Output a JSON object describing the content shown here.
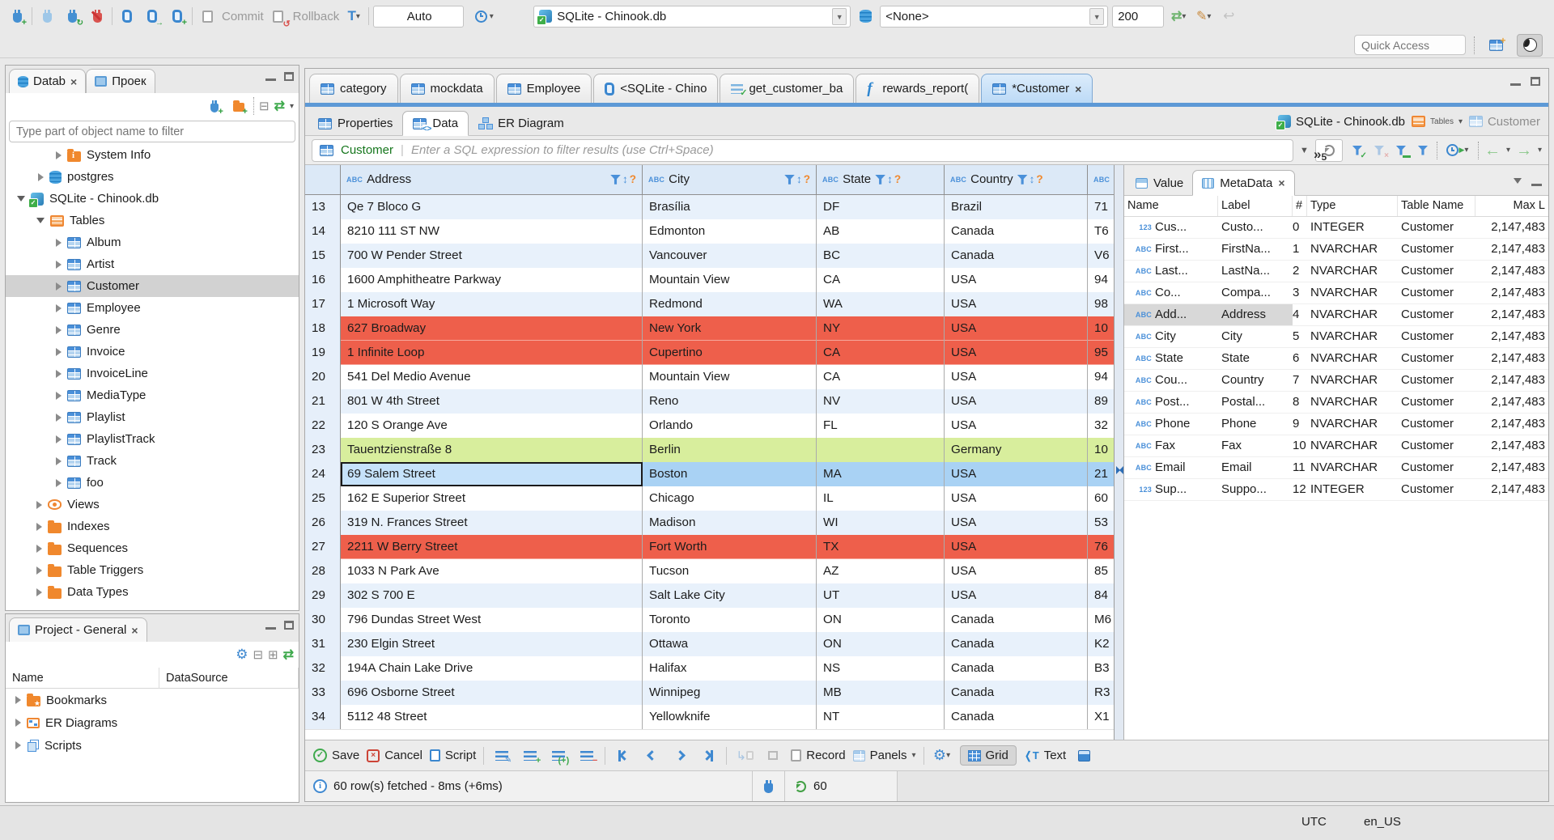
{
  "window": {
    "quick_access": "Quick Access"
  },
  "toolbar": {
    "commit": "Commit",
    "rollback": "Rollback",
    "auto": "Auto",
    "connection": "SQLite - Chinook.db",
    "schema": "<None>",
    "fetch_size": "200"
  },
  "left": {
    "nav_tab": "Datab",
    "nav_tab2": "Проек",
    "filter_placeholder": "Type part of object name to filter",
    "tree": [
      {
        "label": "System Info",
        "icon": "foldinfo",
        "arrow": "r",
        "ind": 62
      },
      {
        "label": "postgres",
        "icon": "db",
        "arrow": "r",
        "ind": 40
      },
      {
        "label": "SQLite - Chinook.db",
        "icon": "sqlite",
        "arrow": "d",
        "ind": 14
      },
      {
        "label": "Tables",
        "icon": "ftable",
        "arrow": "d",
        "ind": 38
      },
      {
        "label": "Album",
        "icon": "table",
        "arrow": "r",
        "ind": 62
      },
      {
        "label": "Artist",
        "icon": "table",
        "arrow": "r",
        "ind": 62
      },
      {
        "label": "Customer",
        "icon": "table",
        "arrow": "r",
        "ind": 62,
        "sel": "sel"
      },
      {
        "label": "Employee",
        "icon": "table",
        "arrow": "r",
        "ind": 62
      },
      {
        "label": "Genre",
        "icon": "table",
        "arrow": "r",
        "ind": 62
      },
      {
        "label": "Invoice",
        "icon": "table",
        "arrow": "r",
        "ind": 62
      },
      {
        "label": "InvoiceLine",
        "icon": "table",
        "arrow": "r",
        "ind": 62
      },
      {
        "label": "MediaType",
        "icon": "table",
        "arrow": "r",
        "ind": 62
      },
      {
        "label": "Playlist",
        "icon": "table",
        "arrow": "r",
        "ind": 62
      },
      {
        "label": "PlaylistTrack",
        "icon": "table",
        "arrow": "r",
        "ind": 62
      },
      {
        "label": "Track",
        "icon": "table",
        "arrow": "r",
        "ind": 62
      },
      {
        "label": "foo",
        "icon": "table",
        "arrow": "r",
        "ind": 62
      },
      {
        "label": "Views",
        "icon": "eye",
        "arrow": "r",
        "ind": 38
      },
      {
        "label": "Indexes",
        "icon": "folder",
        "arrow": "r",
        "ind": 38
      },
      {
        "label": "Sequences",
        "icon": "folder",
        "arrow": "r",
        "ind": 38
      },
      {
        "label": "Table Triggers",
        "icon": "folder",
        "arrow": "r",
        "ind": 38
      },
      {
        "label": "Data Types",
        "icon": "folder",
        "arrow": "r",
        "ind": 38
      }
    ],
    "project_tab": "Project - General",
    "project_cols": [
      "Name",
      "DataSource"
    ],
    "project_items": [
      {
        "label": "Bookmarks",
        "icon": "foldstar"
      },
      {
        "label": "ER Diagrams",
        "icon": "er"
      },
      {
        "label": "Scripts",
        "icon": "pages"
      }
    ]
  },
  "editor_tabs": [
    {
      "label": "category",
      "icon": "table"
    },
    {
      "label": "mockdata",
      "icon": "table"
    },
    {
      "label": "Employee",
      "icon": "table"
    },
    {
      "label": "<SQLite - Chino",
      "icon": "sqlpage"
    },
    {
      "label": "get_customer_ba",
      "icon": "script"
    },
    {
      "label": "rewards_report(",
      "icon": "func"
    },
    {
      "label": "*Customer",
      "icon": "table",
      "state": "active"
    }
  ],
  "tabs_overflow": "5",
  "subtabs": [
    {
      "label": "Properties",
      "icon": "table"
    },
    {
      "label": "Data",
      "icon": "datagrid",
      "state": "active"
    },
    {
      "label": "ER Diagram",
      "icon": "orgchart"
    }
  ],
  "breadcrumb": [
    {
      "label": "SQLite - Chinook.db",
      "icon": "sqlite"
    },
    {
      "label": "Tables",
      "icon": "ftable",
      "caret": "caret"
    },
    {
      "label": "Customer",
      "icon": "tablelite",
      "dim": "dim"
    }
  ],
  "filterbar": {
    "entity": "Customer",
    "placeholder": "Enter a SQL expression to filter results (use Ctrl+Space)"
  },
  "grid": {
    "columns": [
      {
        "label": "Address"
      },
      {
        "label": "City"
      },
      {
        "label": "State"
      },
      {
        "label": "Country"
      }
    ],
    "rows": [
      {
        "n": "13",
        "address": "Qe 7 Bloco G",
        "city": "Brasília",
        "state": "DF",
        "country": "Brazil",
        "postal": "71",
        "t": "odd"
      },
      {
        "n": "14",
        "address": "8210 111 ST NW",
        "city": "Edmonton",
        "state": "AB",
        "country": "Canada",
        "postal": "T6",
        "t": "even"
      },
      {
        "n": "15",
        "address": "700 W Pender Street",
        "city": "Vancouver",
        "state": "BC",
        "country": "Canada",
        "postal": "V6",
        "t": "odd"
      },
      {
        "n": "16",
        "address": "1600 Amphitheatre Parkway",
        "city": "Mountain View",
        "state": "CA",
        "country": "USA",
        "postal": "94",
        "t": "even"
      },
      {
        "n": "17",
        "address": "1 Microsoft Way",
        "city": "Redmond",
        "state": "WA",
        "country": "USA",
        "postal": "98",
        "t": "odd"
      },
      {
        "n": "18",
        "address": "627 Broadway",
        "city": "New York",
        "state": "NY",
        "country": "USA",
        "postal": "10",
        "t": "red"
      },
      {
        "n": "19",
        "address": "1 Infinite Loop",
        "city": "Cupertino",
        "state": "CA",
        "country": "USA",
        "postal": "95",
        "t": "red"
      },
      {
        "n": "20",
        "address": "541 Del Medio Avenue",
        "city": "Mountain View",
        "state": "CA",
        "country": "USA",
        "postal": "94",
        "t": "even"
      },
      {
        "n": "21",
        "address": "801 W 4th Street",
        "city": "Reno",
        "state": "NV",
        "country": "USA",
        "postal": "89",
        "t": "odd"
      },
      {
        "n": "22",
        "address": "120 S Orange Ave",
        "city": "Orlando",
        "state": "FL",
        "country": "USA",
        "postal": "32",
        "t": "even"
      },
      {
        "n": "23",
        "address": "Tauentzienstraße 8",
        "city": "Berlin",
        "state": "",
        "country": "Germany",
        "postal": "10",
        "t": "green"
      },
      {
        "n": "24",
        "address": "69 Salem Street",
        "city": "Boston",
        "state": "MA",
        "country": "USA",
        "postal": "21",
        "t": "sel"
      },
      {
        "n": "25",
        "address": "162 E Superior Street",
        "city": "Chicago",
        "state": "IL",
        "country": "USA",
        "postal": "60",
        "t": "even"
      },
      {
        "n": "26",
        "address": "319 N. Frances Street",
        "city": "Madison",
        "state": "WI",
        "country": "USA",
        "postal": "53",
        "t": "odd"
      },
      {
        "n": "27",
        "address": "2211 W Berry Street",
        "city": "Fort Worth",
        "state": "TX",
        "country": "USA",
        "postal": "76",
        "t": "red"
      },
      {
        "n": "28",
        "address": "1033 N Park Ave",
        "city": "Tucson",
        "state": "AZ",
        "country": "USA",
        "postal": "85",
        "t": "even"
      },
      {
        "n": "29",
        "address": "302 S 700 E",
        "city": "Salt Lake City",
        "state": "UT",
        "country": "USA",
        "postal": "84",
        "t": "odd"
      },
      {
        "n": "30",
        "address": "796 Dundas Street West",
        "city": "Toronto",
        "state": "ON",
        "country": "Canada",
        "postal": "M6",
        "t": "even"
      },
      {
        "n": "31",
        "address": "230 Elgin Street",
        "city": "Ottawa",
        "state": "ON",
        "country": "Canada",
        "postal": "K2",
        "t": "odd"
      },
      {
        "n": "32",
        "address": "194A Chain Lake Drive",
        "city": "Halifax",
        "state": "NS",
        "country": "Canada",
        "postal": "B3",
        "t": "even"
      },
      {
        "n": "33",
        "address": "696 Osborne Street",
        "city": "Winnipeg",
        "state": "MB",
        "country": "Canada",
        "postal": "R3",
        "t": "odd"
      },
      {
        "n": "34",
        "address": "5112 48 Street",
        "city": "Yellowknife",
        "state": "NT",
        "country": "Canada",
        "postal": "X1",
        "t": "even"
      }
    ]
  },
  "value_panel": {
    "tabs": [
      "Value",
      "MetaData"
    ],
    "columns": [
      "Name",
      "Label",
      "#",
      "Type",
      "Table Name",
      "Max L"
    ],
    "rows": [
      {
        "glyph": "123",
        "name": "Cus...",
        "label": "Custo...",
        "num": "0",
        "type": "INTEGER",
        "table": "Customer",
        "max": "2,147,483"
      },
      {
        "glyph": "ABC",
        "name": "First...",
        "label": "FirstNa...",
        "num": "1",
        "type": "NVARCHAR",
        "table": "Customer",
        "max": "2,147,483"
      },
      {
        "glyph": "ABC",
        "name": "Last...",
        "label": "LastNa...",
        "num": "2",
        "type": "NVARCHAR",
        "table": "Customer",
        "max": "2,147,483"
      },
      {
        "glyph": "ABC",
        "name": "Co...",
        "label": "Compa...",
        "num": "3",
        "type": "NVARCHAR",
        "table": "Customer",
        "max": "2,147,483"
      },
      {
        "glyph": "ABC",
        "name": "Add...",
        "label": "Address",
        "num": "4",
        "type": "NVARCHAR",
        "table": "Customer",
        "max": "2,147,483",
        "sel": "msel"
      },
      {
        "glyph": "ABC",
        "name": "City",
        "label": "City",
        "num": "5",
        "type": "NVARCHAR",
        "table": "Customer",
        "max": "2,147,483"
      },
      {
        "glyph": "ABC",
        "name": "State",
        "label": "State",
        "num": "6",
        "type": "NVARCHAR",
        "table": "Customer",
        "max": "2,147,483"
      },
      {
        "glyph": "ABC",
        "name": "Cou...",
        "label": "Country",
        "num": "7",
        "type": "NVARCHAR",
        "table": "Customer",
        "max": "2,147,483"
      },
      {
        "glyph": "ABC",
        "name": "Post...",
        "label": "Postal...",
        "num": "8",
        "type": "NVARCHAR",
        "table": "Customer",
        "max": "2,147,483"
      },
      {
        "glyph": "ABC",
        "name": "Phone",
        "label": "Phone",
        "num": "9",
        "type": "NVARCHAR",
        "table": "Customer",
        "max": "2,147,483"
      },
      {
        "glyph": "ABC",
        "name": "Fax",
        "label": "Fax",
        "num": "10",
        "type": "NVARCHAR",
        "table": "Customer",
        "max": "2,147,483"
      },
      {
        "glyph": "ABC",
        "name": "Email",
        "label": "Email",
        "num": "11",
        "type": "NVARCHAR",
        "table": "Customer",
        "max": "2,147,483"
      },
      {
        "glyph": "123",
        "name": "Sup...",
        "label": "Suppo...",
        "num": "12",
        "type": "INTEGER",
        "table": "Customer",
        "max": "2,147,483"
      }
    ]
  },
  "resultbar": {
    "save": "Save",
    "cancel": "Cancel",
    "script": "Script",
    "record": "Record",
    "panels": "Panels",
    "grid": "Grid",
    "text": "Text"
  },
  "status": {
    "fetched": "60 row(s) fetched - 8ms (+6ms)",
    "count": "60"
  },
  "statusbar": {
    "tz": "UTC",
    "locale": "en_US"
  },
  "colors": {
    "accent": "#4a90d9",
    "row_red": "#ee5f4b",
    "row_green": "#d8ee9d",
    "row_selected": "#a9d2f4",
    "row_striped": "#e8f1fb",
    "header_bg": "#dce9f7"
  }
}
